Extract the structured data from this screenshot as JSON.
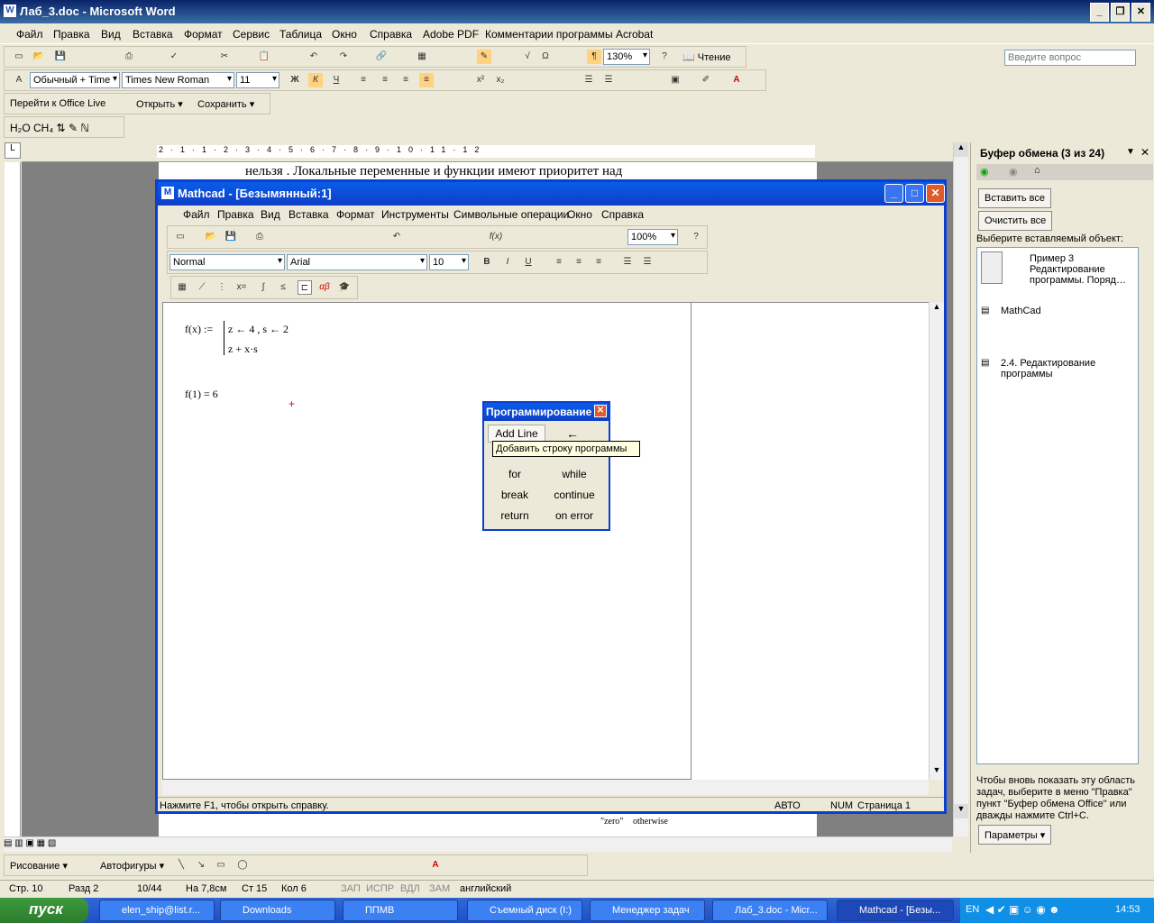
{
  "word": {
    "title": "Лаб_3.doc - Microsoft Word",
    "menu": [
      "Файл",
      "Правка",
      "Вид",
      "Вставка",
      "Формат",
      "Сервис",
      "Таблица",
      "Окно",
      "Справка",
      "Adobe PDF",
      "Комментарии программы Acrobat"
    ],
    "ask_placeholder": "Введите вопрос",
    "zoom": "130%",
    "reading": "Чтение",
    "style": "Обычный + Time",
    "font": "Times New Roman",
    "size": "11",
    "office_live": "Перейти к Office Live",
    "open": "Открыть ▾",
    "save": "Сохранить ▾",
    "doc_top_text": "нельзя . Локальные переменные и функции имеют приоритет над",
    "doc_cell_1": "\"zero\"",
    "doc_cell_2": "otherwise",
    "drawing": "Рисование ▾",
    "autoshapes": "Автофигуры ▾"
  },
  "mathcad": {
    "title": "Mathcad - [Безымянный:1]",
    "menu": [
      "Файл",
      "Правка",
      "Вид",
      "Вставка",
      "Формат",
      "Инструменты",
      "Символьные операции",
      "Окно",
      "Справка"
    ],
    "zoom": "100%",
    "style": "Normal",
    "font": "Arial",
    "size": "10",
    "math": {
      "def_lhs": "f(x) :=",
      "line1": "z ← 4 , s ← 2",
      "line2": "z + x·s",
      "eval": "f(1) = 6"
    },
    "status": {
      "help": "Нажмите F1, чтобы открыть справку.",
      "auto": "АВТО",
      "num": "NUM",
      "page": "Страница 1"
    }
  },
  "prog_toolbar": {
    "title": "Программирование",
    "add_line": "Add Line",
    "arrow": "←",
    "tooltip": "Добавить строку программы",
    "buttons": [
      [
        "for",
        "while"
      ],
      [
        "break",
        "continue"
      ],
      [
        "return",
        "on error"
      ]
    ]
  },
  "taskpane": {
    "title": "Буфер обмена (3 из 24)",
    "paste_all": "Вставить все",
    "clear_all": "Очистить все",
    "choose": "Выберите вставляемый объект:",
    "items": [
      "Пример 3 Редактирование программы. Поряд…",
      "MathCad",
      "2.4. Редактирование программы"
    ],
    "hint": "Чтобы вновь показать эту область задач, выберите в меню \"Правка\" пункт \"Буфер обмена Office\" или дважды нажмите Ctrl+C.",
    "params": "Параметры ▾"
  },
  "status": {
    "page": "Стр. 10",
    "section": "Разд 2",
    "count": "10/44",
    "at": "На 7,8см",
    "line": "Ст 15",
    "col": "Кол 6",
    "rec": "ЗАП",
    "trk": "ИСПР",
    "ext": "ВДЛ",
    "ovr": "ЗАМ",
    "lang": "английский"
  },
  "taskbar": {
    "start": "пуск",
    "tasks": [
      "elen_ship@list.r...",
      "Downloads",
      "ППМВ",
      "Съемный диск (I:)",
      "Менеджер задач",
      "Лаб_3.doc - Micr...",
      "Mathcad - [Безы..."
    ],
    "lang": "EN",
    "time": "14:53"
  }
}
